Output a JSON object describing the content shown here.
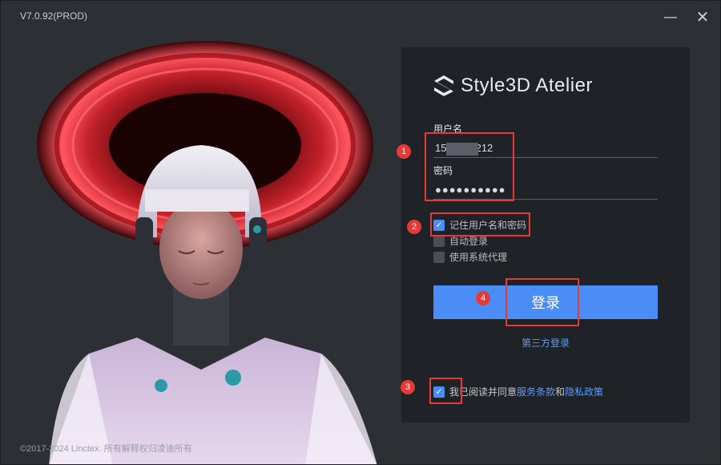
{
  "titlebar": {
    "version": "V7.0.92(PROD)",
    "minimize_glyph": "—",
    "close_glyph": "✕"
  },
  "brand": {
    "name": "Style3D Atelier",
    "logo_icon": "style3d-logo-icon"
  },
  "login": {
    "username_label": "用户名",
    "username_value": "151        212",
    "password_label": "密码",
    "password_value": "●●●●●●●●●●",
    "remember_label": "记住用户名和密码",
    "remember_checked": true,
    "auto_login_label": "自动登录",
    "auto_login_checked": false,
    "proxy_label": "使用系统代理",
    "proxy_checked": false,
    "submit_label": "登录",
    "third_party_label": "第三方登录"
  },
  "agreement": {
    "checked": true,
    "prefix": "我已阅读并同意",
    "terms": "服务条款",
    "and": "和",
    "privacy": "隐私政策"
  },
  "footer": {
    "copyright": "©2017-2024 Linctex. 所有解释权归凌迪所有"
  },
  "annotations": {
    "labels": [
      "1",
      "2",
      "3",
      "4"
    ],
    "color": "#e53935"
  },
  "colors": {
    "accent": "#4a8df6",
    "link": "#5d9bf8",
    "panel_bg": "#1f2227",
    "window_bg": "#2c2f34"
  }
}
